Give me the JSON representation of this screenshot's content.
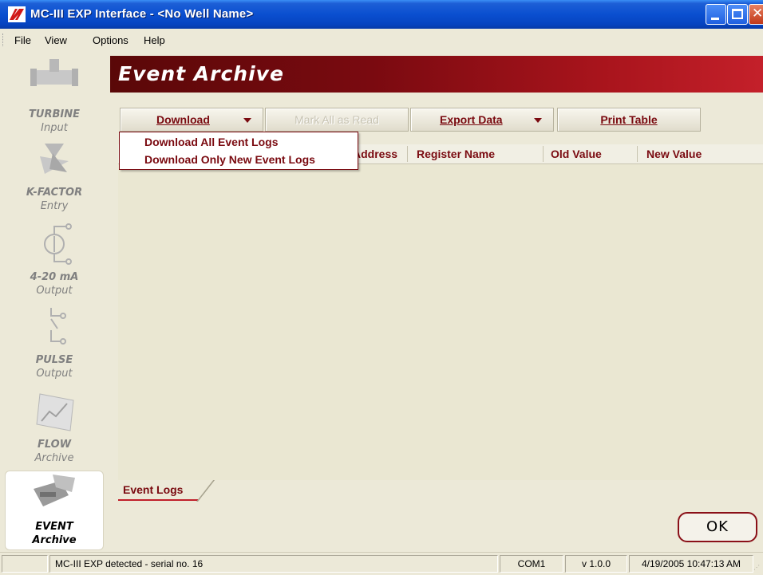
{
  "window": {
    "title": "MC-III EXP Interface - <No Well Name>"
  },
  "menu": [
    "File",
    "View",
    "Options",
    "Help"
  ],
  "sidebar": {
    "items": [
      {
        "line1": "TURBINE",
        "line2": "Input",
        "icon": "turbine-icon"
      },
      {
        "line1": "K-FACTOR",
        "line2": "Entry",
        "icon": "k-factor-icon"
      },
      {
        "line1": "4-20 mA",
        "line2": "Output",
        "icon": "analog-output-icon"
      },
      {
        "line1": "PULSE",
        "line2": "Output",
        "icon": "pulse-output-icon"
      },
      {
        "line1": "FLOW",
        "line2": "Archive",
        "icon": "flow-archive-icon"
      },
      {
        "line1": "EVENT",
        "line2": "Archive",
        "icon": "event-archive-icon",
        "active": true
      }
    ]
  },
  "header": {
    "title": "Event Archive"
  },
  "toolbar": {
    "download": "Download",
    "mark_all_read": "Mark All as Read",
    "export_data": "Export Data",
    "print_table": "Print Table"
  },
  "dropdown": {
    "items": [
      "Download All Event Logs",
      "Download Only New Event Logs"
    ]
  },
  "table": {
    "columns": [
      "Address",
      "Register Name",
      "Old Value",
      "New Value"
    ],
    "rows": []
  },
  "tabs": [
    "Event Logs"
  ],
  "ok_label": "OK",
  "statusbar": {
    "message": "MC-III EXP detected - serial no. 16",
    "port": "COM1",
    "version": "v 1.0.0",
    "datetime": "4/19/2005 10:47:13 AM"
  },
  "colors": {
    "accent": "#7a0a10",
    "banner_dark": "#5a0808",
    "banner_light": "#c4202a",
    "title_bar": "#0a4fd0"
  }
}
